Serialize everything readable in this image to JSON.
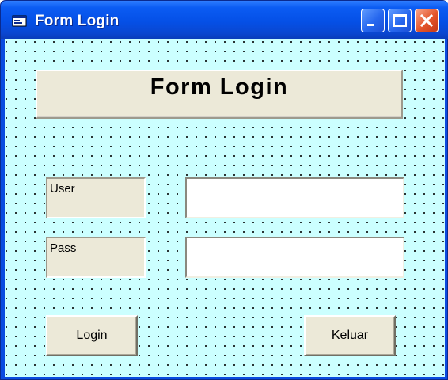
{
  "window": {
    "title": "Form Login",
    "controls": {
      "minimize_icon": "minimize-icon",
      "maximize_icon": "maximize-icon",
      "close_icon": "close-icon"
    }
  },
  "form": {
    "header": "Form Login",
    "fields": [
      {
        "label": "User",
        "value": ""
      },
      {
        "label": "Pass",
        "value": ""
      }
    ],
    "buttons": {
      "login": "Login",
      "exit": "Keluar"
    }
  },
  "colors": {
    "titlebar": "#0550e6",
    "client_background": "#ccffff",
    "control_face": "#ece9d8",
    "close_button": "#e4552a"
  }
}
